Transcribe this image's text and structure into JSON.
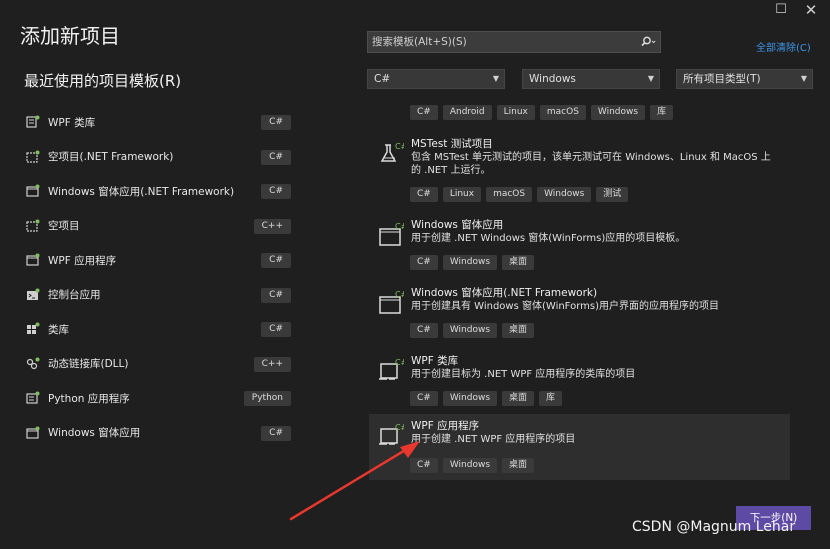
{
  "window": {
    "maximize_icon": "maximize-icon",
    "close_icon": "close-icon",
    "maximize_glyph": "☐",
    "close_glyph": "✕"
  },
  "dialog": {
    "title": "添加新项目"
  },
  "recent": {
    "title": "最近使用的项目模板(R)",
    "items": [
      {
        "label": "WPF 类库",
        "lang": "C#"
      },
      {
        "label": "空项目(.NET Framework)",
        "lang": "C#"
      },
      {
        "label": "Windows 窗体应用(.NET Framework)",
        "lang": "C#"
      },
      {
        "label": "空项目",
        "lang": "C++"
      },
      {
        "label": "WPF 应用程序",
        "lang": "C#"
      },
      {
        "label": "控制台应用",
        "lang": "C#"
      },
      {
        "label": "类库",
        "lang": "C#"
      },
      {
        "label": "动态链接库(DLL)",
        "lang": "C++"
      },
      {
        "label": "Python 应用程序",
        "lang": "Python"
      },
      {
        "label": "Windows 窗体应用",
        "lang": "C#"
      }
    ]
  },
  "search": {
    "placeholder": "搜索模板(Alt+S)(S)",
    "icon": "search-icon"
  },
  "clear_all": "全部清除(C)",
  "filters": {
    "language": "C#",
    "platform": "Windows",
    "project_type": "所有项目类型(T)"
  },
  "top_tags": [
    "C#",
    "Android",
    "Linux",
    "macOS",
    "Windows",
    "库"
  ],
  "templates": [
    {
      "name": "MSTest 测试项目",
      "desc": "包含 MSTest 单元测试的项目，该单元测试可在 Windows、Linux 和 MacOS 上的 .NET 上运行。",
      "tags": [
        "C#",
        "Linux",
        "macOS",
        "Windows",
        "测试"
      ]
    },
    {
      "name": "Windows 窗体应用",
      "desc": "用于创建 .NET Windows 窗体(WinForms)应用的项目模板。",
      "tags": [
        "C#",
        "Windows",
        "桌面"
      ]
    },
    {
      "name": "Windows 窗体应用(.NET Framework)",
      "desc": "用于创建具有 Windows 窗体(WinForms)用户界面的应用程序的项目",
      "tags": [
        "C#",
        "Windows",
        "桌面"
      ]
    },
    {
      "name": "WPF 类库",
      "desc": "用于创建目标为 .NET WPF 应用程序的类库的项目",
      "tags": [
        "C#",
        "Windows",
        "桌面",
        "库"
      ]
    },
    {
      "name": "WPF 应用程序",
      "desc": "用于创建 .NET WPF 应用程序的项目",
      "tags": [
        "C#",
        "Windows",
        "桌面"
      ]
    }
  ],
  "next_button": "下一步(N)",
  "watermark": "CSDN @Magnum Lehar",
  "colors": {
    "background": "#1f1f1f",
    "accent": "#5c4aa4",
    "link": "#3e95e6",
    "arrow": "#e8372c"
  }
}
